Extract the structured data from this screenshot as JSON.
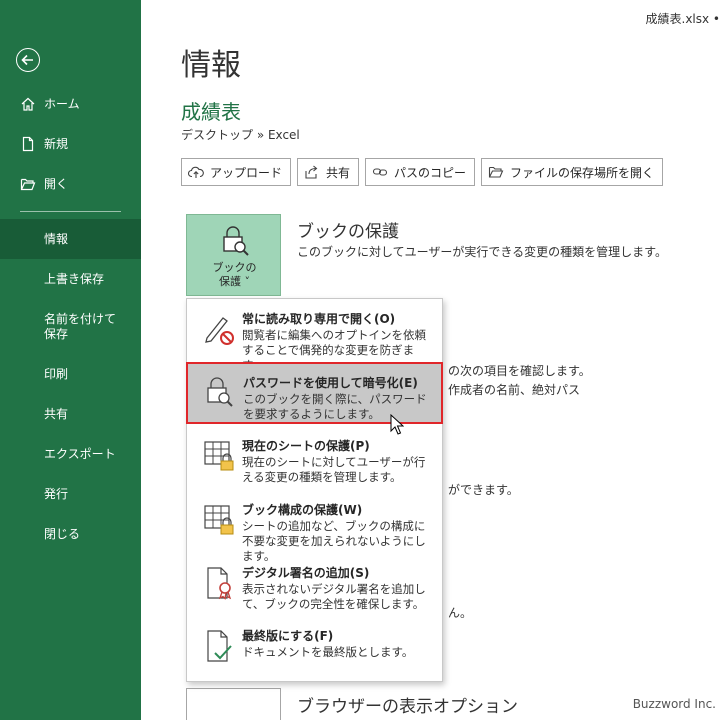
{
  "window": {
    "file_name": "成績表.xlsx •"
  },
  "sidebar": {
    "items": [
      {
        "label": "ホーム"
      },
      {
        "label": "新規"
      },
      {
        "label": "開く"
      },
      {
        "label": "情報"
      },
      {
        "label": "上書き保存"
      },
      {
        "label": "名前を付けて保存"
      },
      {
        "label": "印刷"
      },
      {
        "label": "共有"
      },
      {
        "label": "エクスポート"
      },
      {
        "label": "発行"
      },
      {
        "label": "閉じる"
      }
    ]
  },
  "main": {
    "page_title": "情報",
    "doc_title": "成績表",
    "doc_path": "デスクトップ » Excel",
    "actions": [
      {
        "label": "アップロード"
      },
      {
        "label": "共有"
      },
      {
        "label": "パスのコピー"
      },
      {
        "label": "ファイルの保存場所を開く"
      }
    ],
    "protect": {
      "tile_label_1": "ブックの",
      "tile_label_2": "保護 ˅",
      "title": "ブックの保護",
      "desc": "このブックに対してユーザーが実行できる変更の種類を管理します。"
    },
    "fragments": {
      "f1": "の次の項目を確認します。",
      "f2": "作成者の名前、絶対パス",
      "f3": "ができます。",
      "f4": "ん。"
    },
    "browser": {
      "title": "ブラウザーの表示オプション"
    }
  },
  "dropdown": {
    "items": [
      {
        "title": "常に読み取り専用で開く(O)",
        "desc": "閲覧者に編集へのオプトインを依頼することで偶発的な変更を防ぎます。"
      },
      {
        "title": "パスワードを使用して暗号化(E)",
        "desc": "このブックを開く際に、パスワードを要求するようにします。"
      },
      {
        "title": "現在のシートの保護(P)",
        "desc": "現在のシートに対してユーザーが行える変更の種類を管理します。"
      },
      {
        "title": "ブック構成の保護(W)",
        "desc": "シートの追加など、ブックの構成に不要な変更を加えられないようにします。"
      },
      {
        "title": "デジタル署名の追加(S)",
        "desc": "表示されないデジタル署名を追加して、ブックの完全性を確保します。"
      },
      {
        "title": "最終版にする(F)",
        "desc": "ドキュメントを最終版とします。"
      }
    ]
  },
  "watermark": "Buzzword Inc.",
  "colors": {
    "brand": "#217346",
    "active": "#185c37",
    "highlight_border": "#e0262a"
  }
}
